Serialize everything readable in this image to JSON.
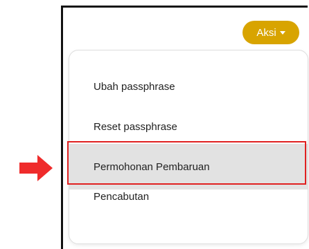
{
  "actions_button": {
    "label": "Aksi"
  },
  "menu": {
    "items": [
      {
        "label": "Ubah passphrase"
      },
      {
        "label": "Reset passphrase"
      },
      {
        "label": "Permohonan Pembaruan",
        "highlighted": true
      },
      {
        "label": "Pencabutan"
      }
    ]
  },
  "colors": {
    "button_bg": "#d8a400",
    "highlight_border": "#e02020",
    "arrow": "#ef2b2b",
    "selected_item_bg": "#e2e2e2"
  },
  "icons": {
    "button_caret": "caret-down-icon",
    "pointer_arrow": "red-arrow-right-icon"
  }
}
